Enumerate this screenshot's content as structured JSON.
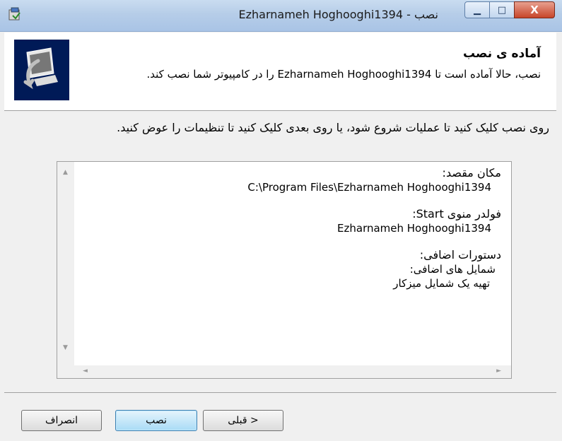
{
  "window": {
    "title": "Ezharnameh Hoghooghi1394 - نصب",
    "buttons": [
      "minimize",
      "maximize",
      "close"
    ],
    "close_glyph": "X",
    "minimize_glyph": "▁",
    "maximize_glyph": "□"
  },
  "header": {
    "title": "آماده ی نصب",
    "subtitle": "نصب، حالا آماده است تا Ezharnameh Hoghooghi1394 را در کامپیوتر شما نصب کند."
  },
  "instruction": "روی نصب کلیک کنید تا عملیات شروع شود، یا روی بعدی کلیک کنید تا تنظیمات را عوض کنید.",
  "memo": {
    "dest_label": "مکان مقصد:",
    "dest_value": "C:\\Program Files\\Ezharnameh Hoghooghi1394",
    "start_label": "فولدر منوی Start:",
    "start_value": "Ezharnameh Hoghooghi1394",
    "tasks_label": "دستورات اضافی:",
    "tasks_group": "شمایل های اضافی:",
    "tasks_item": "تهیه یک شمایل میزکار"
  },
  "buttons": {
    "back": "< قبلی",
    "install": "نصب",
    "cancel": "انصراف"
  },
  "colors": {
    "logo_bg": "#001a57",
    "primary_button": "#a9dbf6",
    "titlebar": "#b6cde8"
  }
}
